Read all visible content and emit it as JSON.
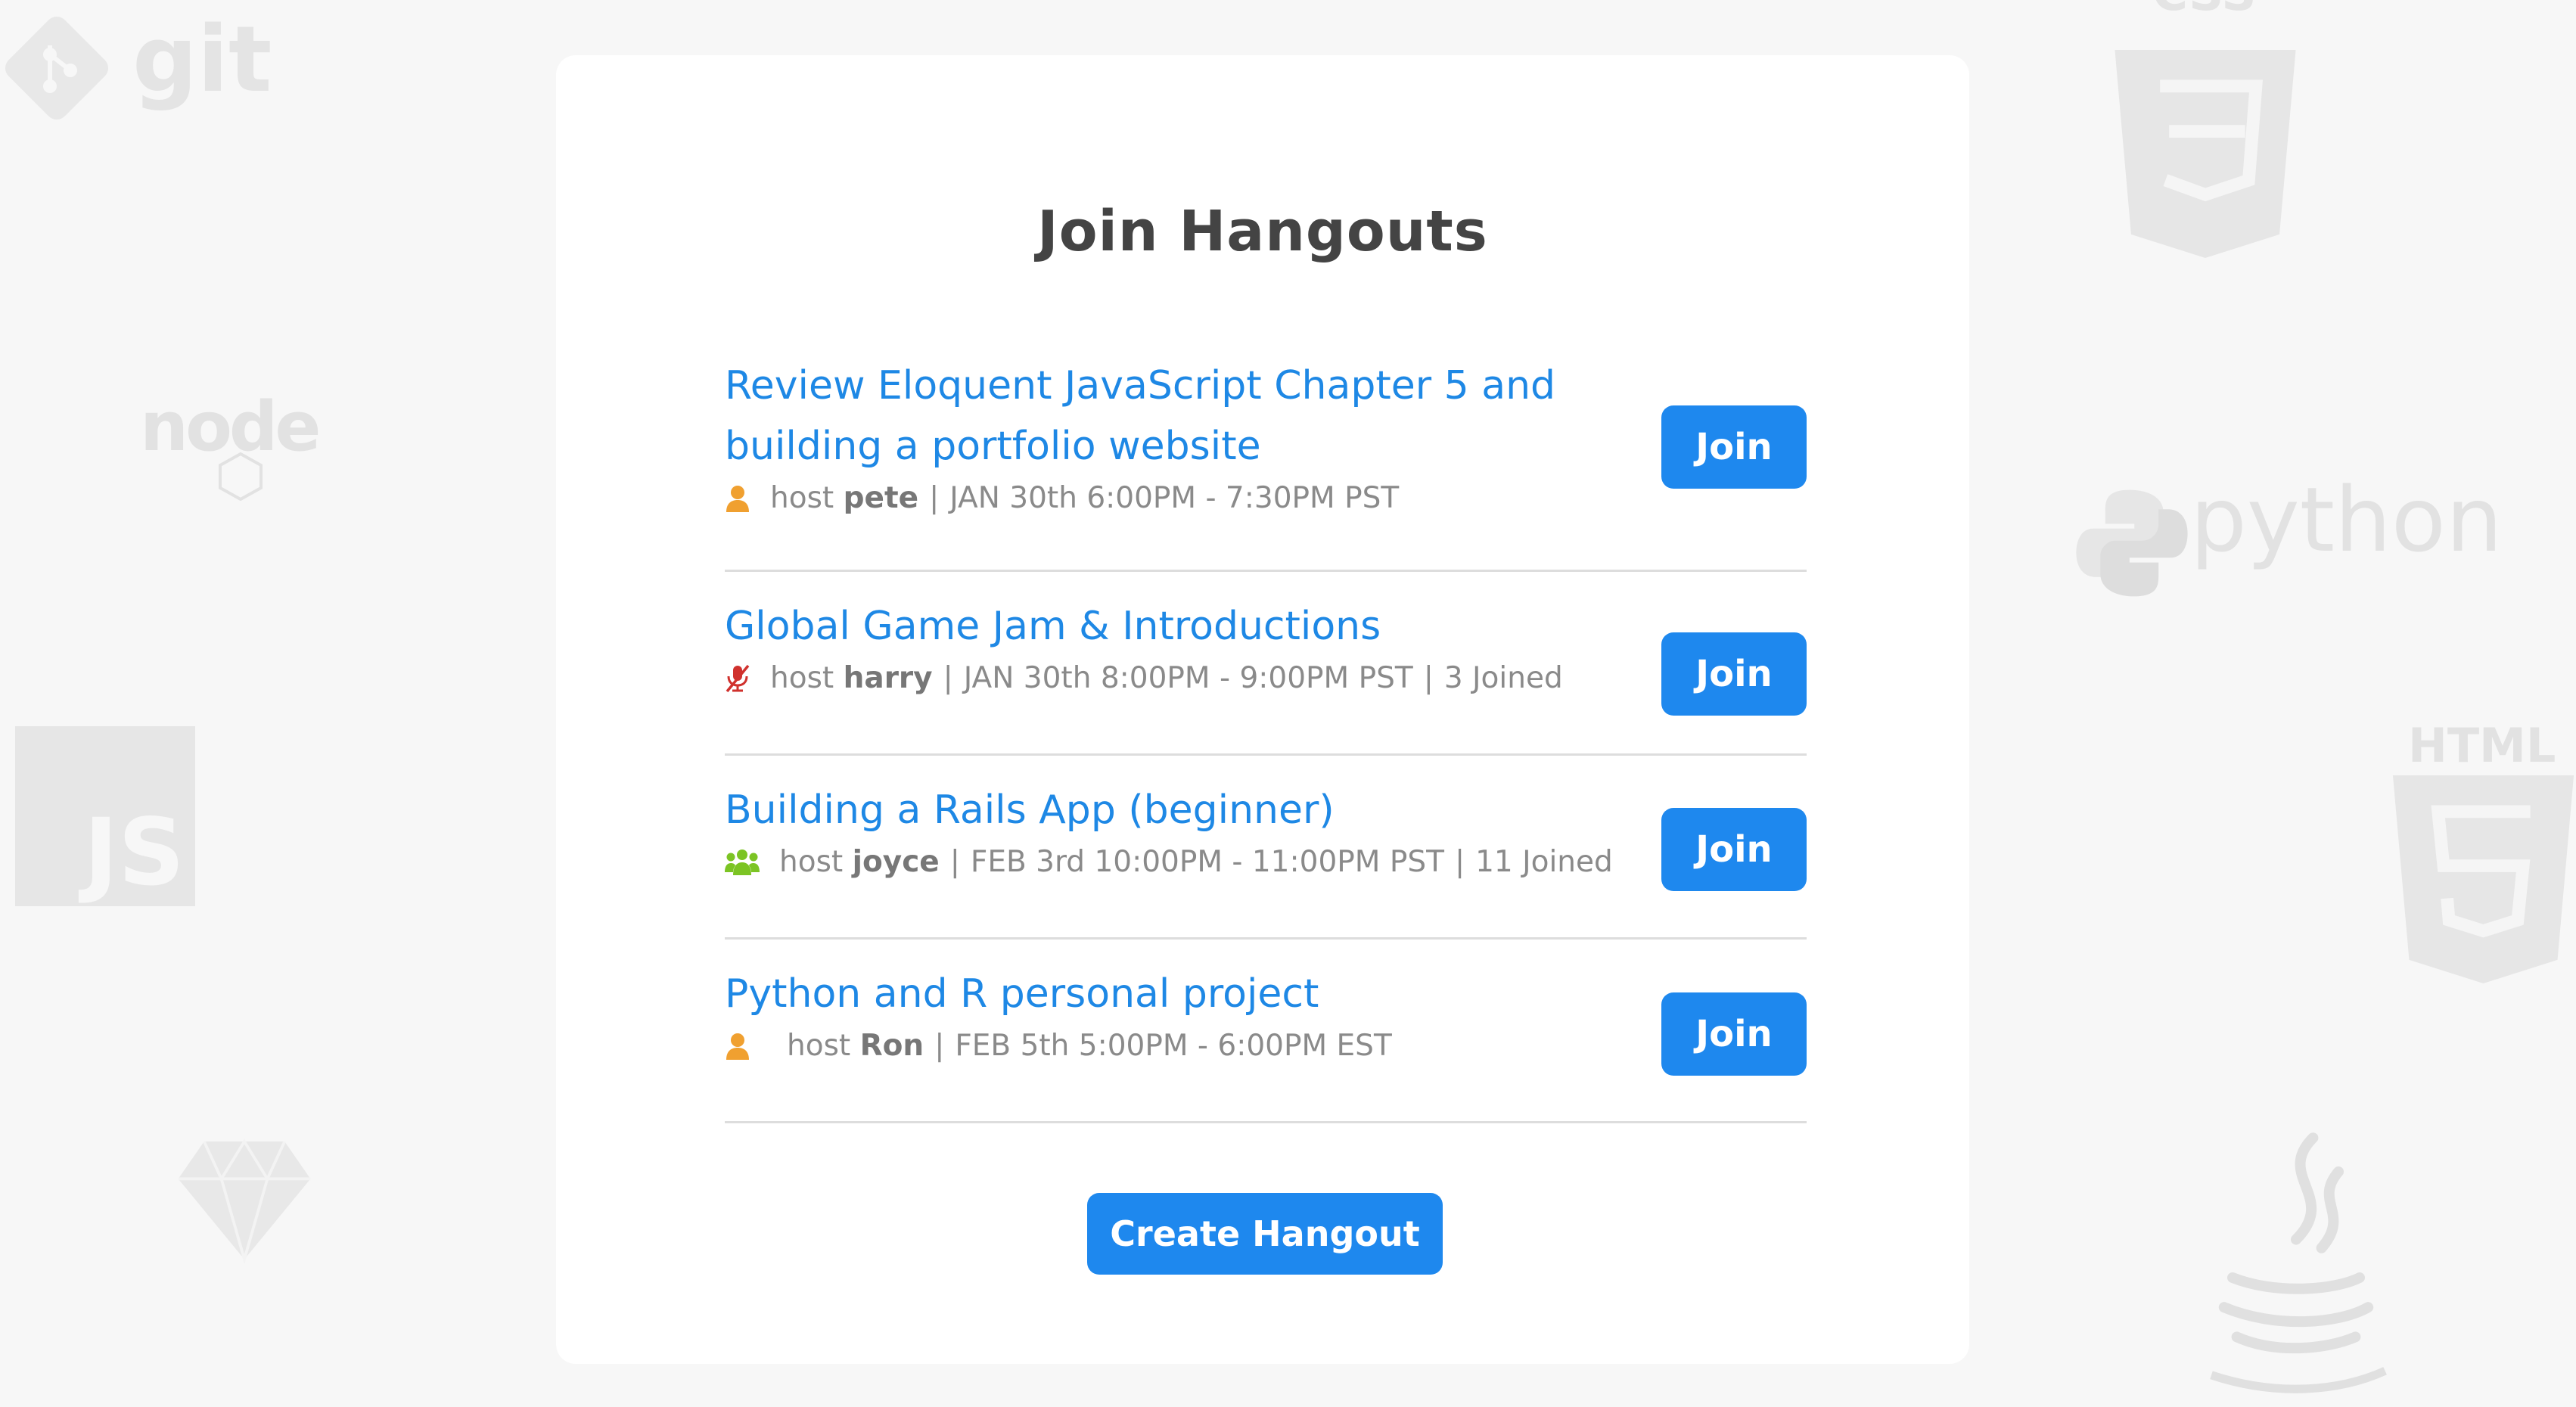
{
  "page": {
    "title": "Join Hangouts",
    "create_button": "Create Hangout"
  },
  "background": {
    "git": "git",
    "node": "node",
    "js": "JS",
    "python": "python",
    "html": "HTML",
    "css": "CSS"
  },
  "hangouts": [
    {
      "title": "Review Eloquent JavaScript Chapter 5 and building a portfolio website",
      "icon": "user-icon",
      "icon_color": "#f0a030",
      "host_label": "host",
      "host": "pete",
      "time": "JAN 30th 6:00PM - 7:30PM PST",
      "joined": "",
      "join_label": "Join"
    },
    {
      "title": "Global Game Jam & Introductions",
      "icon": "mic-off-icon",
      "icon_color": "#d0312d",
      "host_label": "host",
      "host": "harry",
      "time": "JAN 30th 8:00PM - 9:00PM PST",
      "joined": "3 Joined",
      "join_label": "Join"
    },
    {
      "title": "Building a Rails App (beginner)",
      "icon": "group-icon",
      "icon_color": "#7cc424",
      "host_label": "host",
      "host": "joyce",
      "time": "FEB 3rd 10:00PM - 11:00PM PST",
      "joined": "11 Joined",
      "join_label": "Join"
    },
    {
      "title": "Python and R personal project",
      "icon": "user-icon",
      "icon_color": "#f0a030",
      "host_label": "host",
      "host": "Ron",
      "time": "FEB 5th 5:00PM - 6:00PM EST",
      "joined": "",
      "join_label": "Join"
    }
  ]
}
